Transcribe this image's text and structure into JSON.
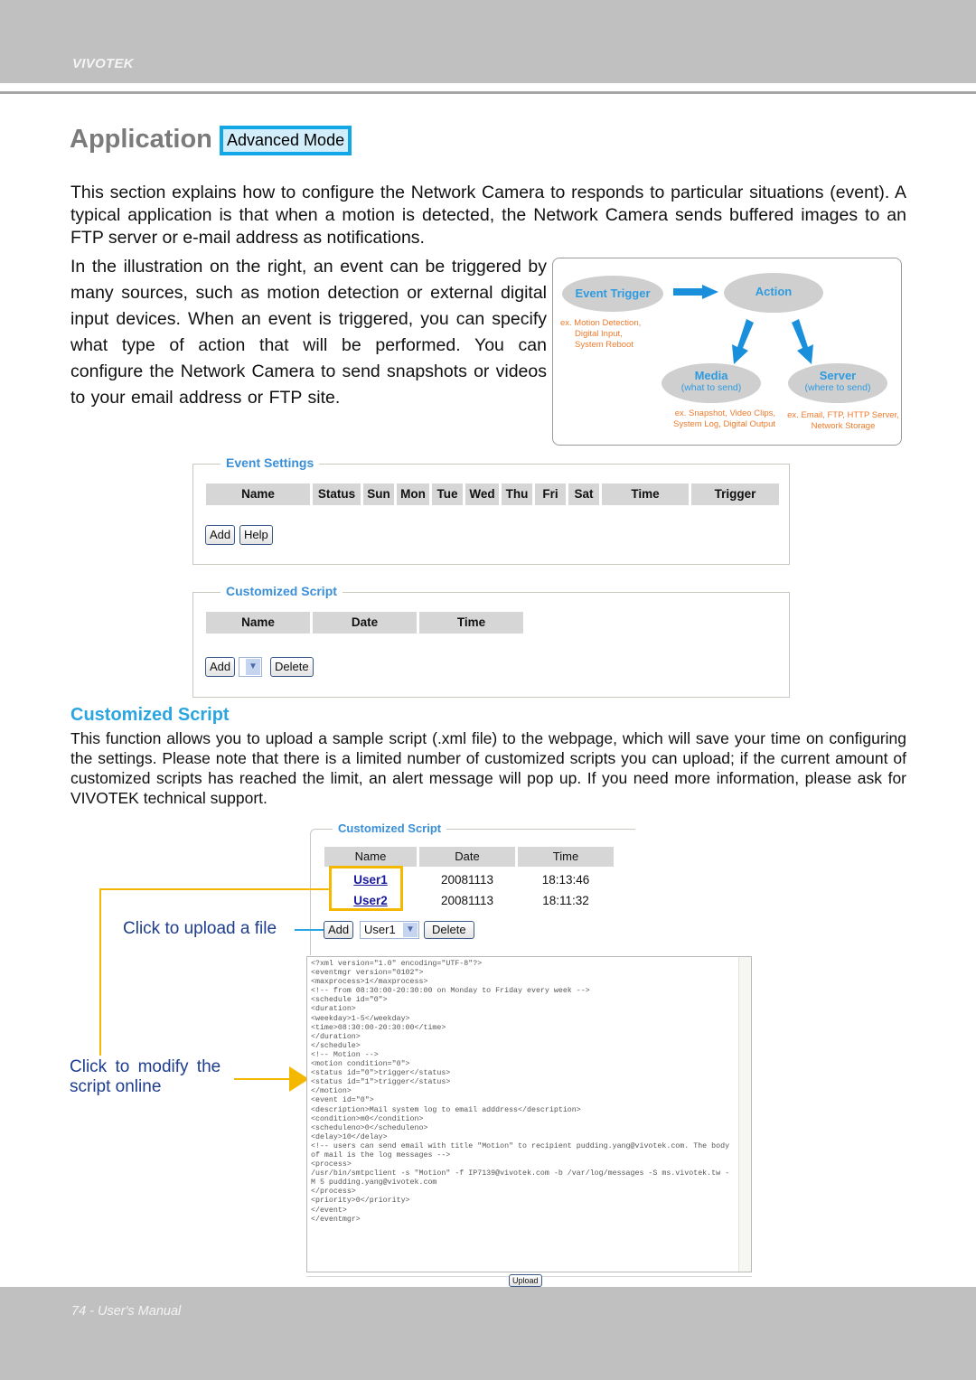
{
  "header": {
    "brand": "VIVOTEK"
  },
  "title": {
    "text": "Application",
    "badge": "Advanced Mode"
  },
  "intro": "This section explains how to configure the Network Camera to responds to particular situations (event). A typical application is that when a motion is detected, the Network Camera sends buffered images to an FTP server or e-mail address as notifications.",
  "side_text": "In the illustration on the right, an event can be triggered by many sources, such as motion detection or external digital input devices. When an event is triggered, you can specify what type of action that will be performed. You can configure the Network Camera to send snapshots or videos to your email address or FTP site.",
  "diagram": {
    "event_trigger": "Event Trigger",
    "action": "Action",
    "trigger_examples": [
      "ex. Motion Detection,",
      "Digital Input,",
      "System Reboot"
    ],
    "media": {
      "label": "Media",
      "sub": "(what to send)",
      "examples": [
        "ex. Snapshot, Video Clips,",
        "System Log, Digital Output"
      ]
    },
    "server": {
      "label": "Server",
      "sub": "(where to send)",
      "examples": [
        "ex. Email, FTP, HTTP Server,",
        "Network Storage"
      ]
    },
    "colors": {
      "ellipse": "#cfcfcf",
      "label": "#2d9be0",
      "note": "#ee7a2c",
      "arrow": "#1a8fdc"
    }
  },
  "event_settings": {
    "legend": "Event Settings",
    "columns": [
      "Name",
      "Status",
      "Sun",
      "Mon",
      "Tue",
      "Wed",
      "Thu",
      "Fri",
      "Sat",
      "Time",
      "Trigger"
    ],
    "buttons": {
      "add": "Add",
      "help": "Help"
    }
  },
  "customized_script_panel": {
    "legend": "Customized Script",
    "columns": [
      "Name",
      "Date",
      "Time"
    ],
    "buttons": {
      "add": "Add",
      "delete": "Delete"
    },
    "select_value": ""
  },
  "section": {
    "heading": "Customized Script",
    "body": "This function allows you to upload a sample script (.xml file) to the webpage, which will save your time on configuring the settings. Please note that there is a limited number of customized scripts you can upload; if the current amount of customized scripts has reached the limit, an alert message will pop up. If you need more information, please ask for VIVOTEK technical support."
  },
  "example_panel": {
    "legend": "Customized Script",
    "columns": [
      "Name",
      "Date",
      "Time"
    ],
    "rows": [
      {
        "name": "User1",
        "date": "20081113",
        "time": "18:13:46"
      },
      {
        "name": "User2",
        "date": "20081113",
        "time": "18:11:32"
      }
    ],
    "buttons": {
      "add": "Add",
      "delete": "Delete",
      "upload": "Upload"
    },
    "select_value": "User1"
  },
  "callouts": {
    "upload": "Click to upload a file",
    "modify_line1": "Click to modify the",
    "modify_line2": "script online",
    "colors": {
      "text": "#1e3d8f",
      "bracket": "#f5b800",
      "connector": "#2ba5e0"
    }
  },
  "script_lines": [
    "<?xml version=\"1.0\" encoding=\"UTF-8\"?>",
    "<eventmgr version=\"0102\">",
    "<maxprocess>1</maxprocess>",
    "<!-- from 08:30:00-20:30:00 on Monday to Friday every week -->",
    "<schedule id=\"0\">",
    "<duration>",
    "<weekday>1-5</weekday>",
    "<time>08:30:00-20:30:00</time>",
    "</duration>",
    "</schedule>",
    "<!-- Motion -->",
    "<motion condition=\"0\">",
    "<status id=\"0\">trigger</status>",
    "<status id=\"1\">trigger</status>",
    "</motion>",
    "<event id=\"0\">",
    "<description>Mail system log to email adddress</description>",
    "<condition>m0</condition>",
    "<scheduleno>0</scheduleno>",
    "<delay>10</delay>",
    "<!-- users can send email with title \"Motion\" to recipient pudding.yang@vivotek.com. The body",
    "of mail is the log messages -->",
    "<process>",
    "/usr/bin/smtpclient -s \"Motion\" -f IP7139@vivotek.com -b /var/log/messages -S ms.vivotek.tw -",
    "M 5 pudding.yang@vivotek.com",
    "</process>",
    "<priority>0</priority>",
    "</event>",
    "</eventmgr>"
  ],
  "footer": {
    "text": "74 - User's Manual"
  }
}
